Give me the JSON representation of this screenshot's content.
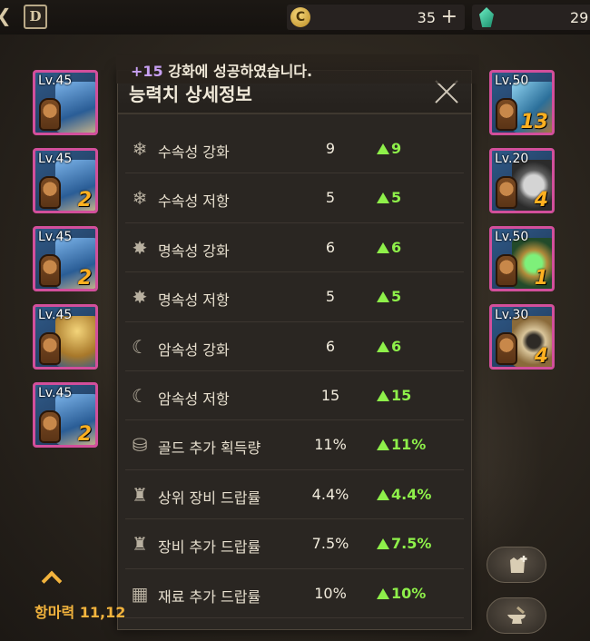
{
  "topbar": {
    "menu_icon": "chevron-left-icon",
    "book_icon": "dungeon-book-icon",
    "book_label": "D",
    "gold": {
      "icon": "c-coin-icon",
      "coin_label": "C",
      "value": "35",
      "add_icon": "plus-icon"
    },
    "gem": {
      "icon": "gem-icon",
      "value": "29"
    }
  },
  "toast": {
    "highlight": "+15",
    "message": " 강화에 성공하였습니다."
  },
  "panel": {
    "title": "능력치 상세정보",
    "close_icon": "close-icon",
    "rows": [
      {
        "icon": "snowflake-icon",
        "glyph": "❄",
        "label": "수속성 강화",
        "value": "9",
        "delta": "9"
      },
      {
        "icon": "snowflake-icon",
        "glyph": "❄",
        "label": "수속성 저항",
        "value": "5",
        "delta": "5"
      },
      {
        "icon": "sunburst-icon",
        "glyph": "✸",
        "label": "명속성 강화",
        "value": "6",
        "delta": "6"
      },
      {
        "icon": "sunburst-icon",
        "glyph": "✸",
        "label": "명속성 저항",
        "value": "5",
        "delta": "5"
      },
      {
        "icon": "crescent-moon-icon",
        "glyph": "☾",
        "label": "암속성 강화",
        "value": "6",
        "delta": "6"
      },
      {
        "icon": "crescent-moon-icon",
        "glyph": "☾",
        "label": "암속성 저항",
        "value": "15",
        "delta": "15"
      },
      {
        "icon": "gold-coins-icon",
        "glyph": "⛁",
        "label": "골드 추가 획득량",
        "value": "11%",
        "delta": "11%"
      },
      {
        "icon": "armor-icon",
        "glyph": "♜",
        "label": "상위 장비 드랍률",
        "value": "4.4%",
        "delta": "4.4%"
      },
      {
        "icon": "armor-icon",
        "glyph": "♜",
        "label": "장비 추가 드랍률",
        "value": "7.5%",
        "delta": "7.5%"
      },
      {
        "icon": "material-box-icon",
        "glyph": "▦",
        "label": "재료 추가 드랍률",
        "value": "10%",
        "delta": "10%"
      }
    ]
  },
  "left_slots": [
    {
      "level": "Lv.45",
      "count": "",
      "art": "blue-armor"
    },
    {
      "level": "Lv.45",
      "count": "2",
      "art": "blue-armor"
    },
    {
      "level": "Lv.45",
      "count": "2",
      "art": "blue-armor"
    },
    {
      "level": "Lv.45",
      "count": "",
      "art": "gold-boots"
    },
    {
      "level": "Lv.45",
      "count": "2",
      "art": "blue-armor"
    }
  ],
  "right_slots": [
    {
      "level": "Lv.50",
      "count": "13",
      "art": "pistol"
    },
    {
      "level": "Lv.20",
      "count": "4",
      "art": "chain-ring"
    },
    {
      "level": "Lv.50",
      "count": "1",
      "art": "emerald-amulet"
    },
    {
      "level": "Lv.30",
      "count": "4",
      "art": "bead-necklace"
    }
  ],
  "footer": {
    "expand_icon": "chevron-up-icon",
    "power": "항마력 11,12",
    "armor_add_icon": "armor-plus-icon",
    "anvil_icon": "anvil-icon"
  },
  "colors": {
    "slot_border": "#d24f9b",
    "delta_green": "#8ef04a",
    "power_gold": "#f2b33d",
    "toast_highlight": "#c7a0f2"
  }
}
